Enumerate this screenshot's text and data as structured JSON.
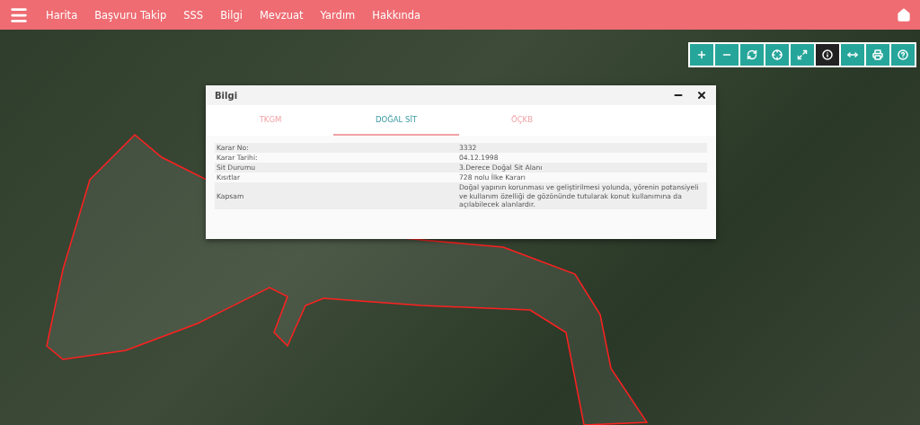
{
  "navbar": {
    "items": [
      "Harita",
      "Başvuru Takip",
      "SSS",
      "Bilgi",
      "Mevzuat",
      "Yardım",
      "Hakkında"
    ]
  },
  "map_tools": [
    {
      "kind": "zoom-in",
      "selected": false
    },
    {
      "kind": "zoom-out",
      "selected": false
    },
    {
      "kind": "refresh",
      "selected": false
    },
    {
      "kind": "locate",
      "selected": false
    },
    {
      "kind": "fullscreen",
      "selected": false
    },
    {
      "kind": "info",
      "selected": true
    },
    {
      "kind": "measure",
      "selected": false
    },
    {
      "kind": "print",
      "selected": false
    },
    {
      "kind": "help",
      "selected": false
    }
  ],
  "dialog": {
    "title": "Bilgi",
    "tabs": [
      {
        "label": "TKGM",
        "selected": false
      },
      {
        "label": "DOĞAL SİT",
        "selected": true
      },
      {
        "label": "ÖÇKB",
        "selected": false
      }
    ],
    "rows": [
      {
        "label": "Karar No:",
        "value": "3332"
      },
      {
        "label": "Karar Tarihi:",
        "value": "04.12.1998"
      },
      {
        "label": "Sit Durumu",
        "value": "3.Derece Doğal Sit Alanı"
      },
      {
        "label": "Kısıtlar",
        "value": "728 nolu İlke Kararı"
      },
      {
        "label": "Kapsam",
        "value": "Doğal yapının korunması ve geliştirilmesi yolunda, yörenin potansiyeli ve kullanım özelliği de gözönünde tutularak konut kullanımına da açılabilecek alanlardır."
      }
    ]
  }
}
